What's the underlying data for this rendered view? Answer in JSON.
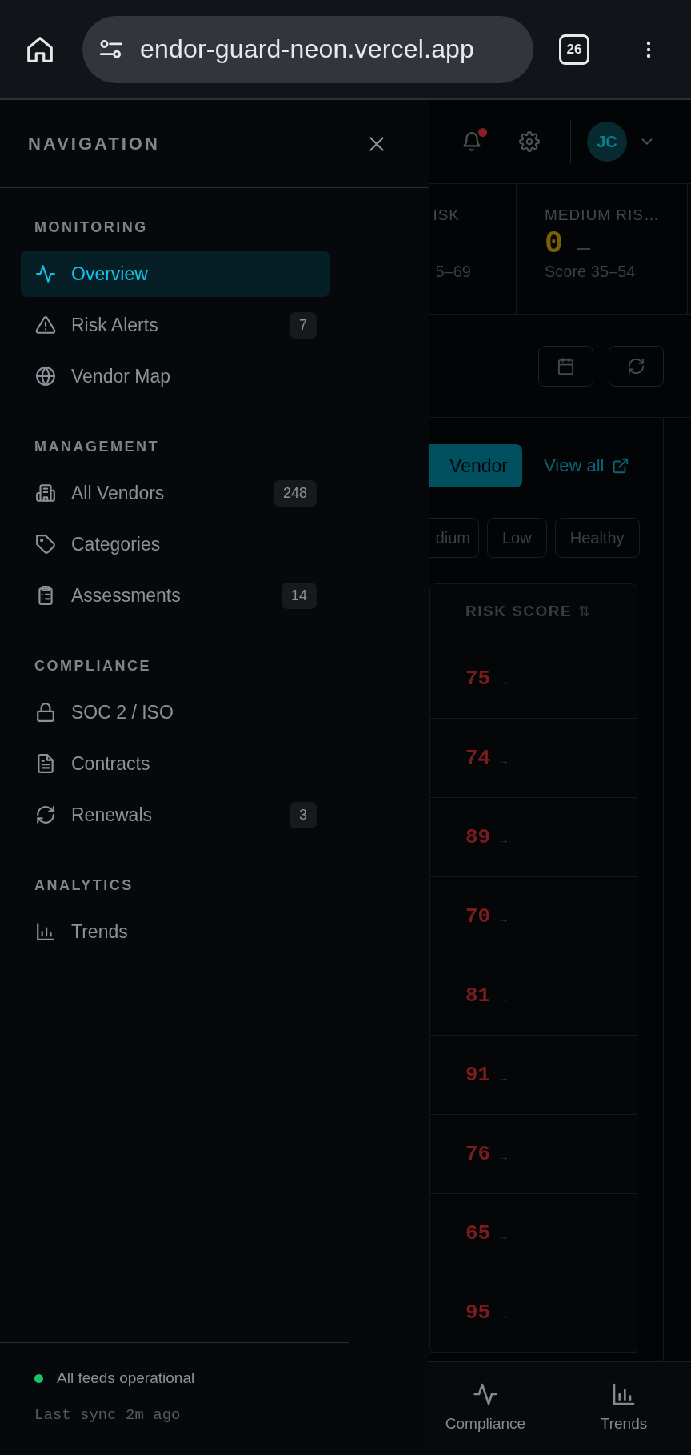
{
  "browser": {
    "url": "endor-guard-neon.vercel.app",
    "tab_count": "26"
  },
  "drawer": {
    "title": "NAVIGATION",
    "sections": [
      {
        "label": "MONITORING",
        "items": [
          {
            "label": "Overview",
            "selected": true
          },
          {
            "label": "Risk Alerts",
            "badge": "7",
            "selected": false
          },
          {
            "label": "Vendor Map",
            "selected": false
          }
        ]
      },
      {
        "label": "MANAGEMENT",
        "items": [
          {
            "label": "All Vendors",
            "badge": "248",
            "selected": false
          },
          {
            "label": "Categories",
            "selected": false
          },
          {
            "label": "Assessments",
            "badge": "14",
            "selected": false
          }
        ]
      },
      {
        "label": "COMPLIANCE",
        "items": [
          {
            "label": "SOC 2 / ISO",
            "selected": false
          },
          {
            "label": "Contracts",
            "selected": false
          },
          {
            "label": "Renewals",
            "badge": "3",
            "selected": false
          }
        ]
      },
      {
        "label": "ANALYTICS",
        "items": [
          {
            "label": "Trends",
            "selected": false
          }
        ]
      }
    ],
    "footer": {
      "status": "All feeds operational",
      "sync": "Last sync 2m ago"
    }
  },
  "page": {
    "header": {
      "unread_notifications": true,
      "avatar": "JC"
    },
    "stats": [
      {
        "label": "ISK",
        "caption": "5–69"
      },
      {
        "label": "MEDIUM RIS…",
        "value": "0",
        "caption": "Score 35–54"
      }
    ],
    "add_button": "Vendor",
    "view_all": "View all",
    "filters": [
      "dium",
      "Low",
      "Healthy"
    ],
    "table": {
      "column": "RISK SCORE",
      "sort": "⇅",
      "rows": [
        {
          "score": "75",
          "trend": "→"
        },
        {
          "score": "74",
          "trend": "→"
        },
        {
          "score": "89",
          "trend": "→"
        },
        {
          "score": "70",
          "trend": "→"
        },
        {
          "score": "81",
          "trend": "→"
        },
        {
          "score": "91",
          "trend": "→"
        },
        {
          "score": "76",
          "trend": "→"
        },
        {
          "score": "65",
          "trend": "→"
        },
        {
          "score": "95",
          "trend": "→"
        }
      ]
    },
    "bottom_nav": [
      {
        "label": "Compliance"
      },
      {
        "label": "Trends"
      }
    ]
  }
}
